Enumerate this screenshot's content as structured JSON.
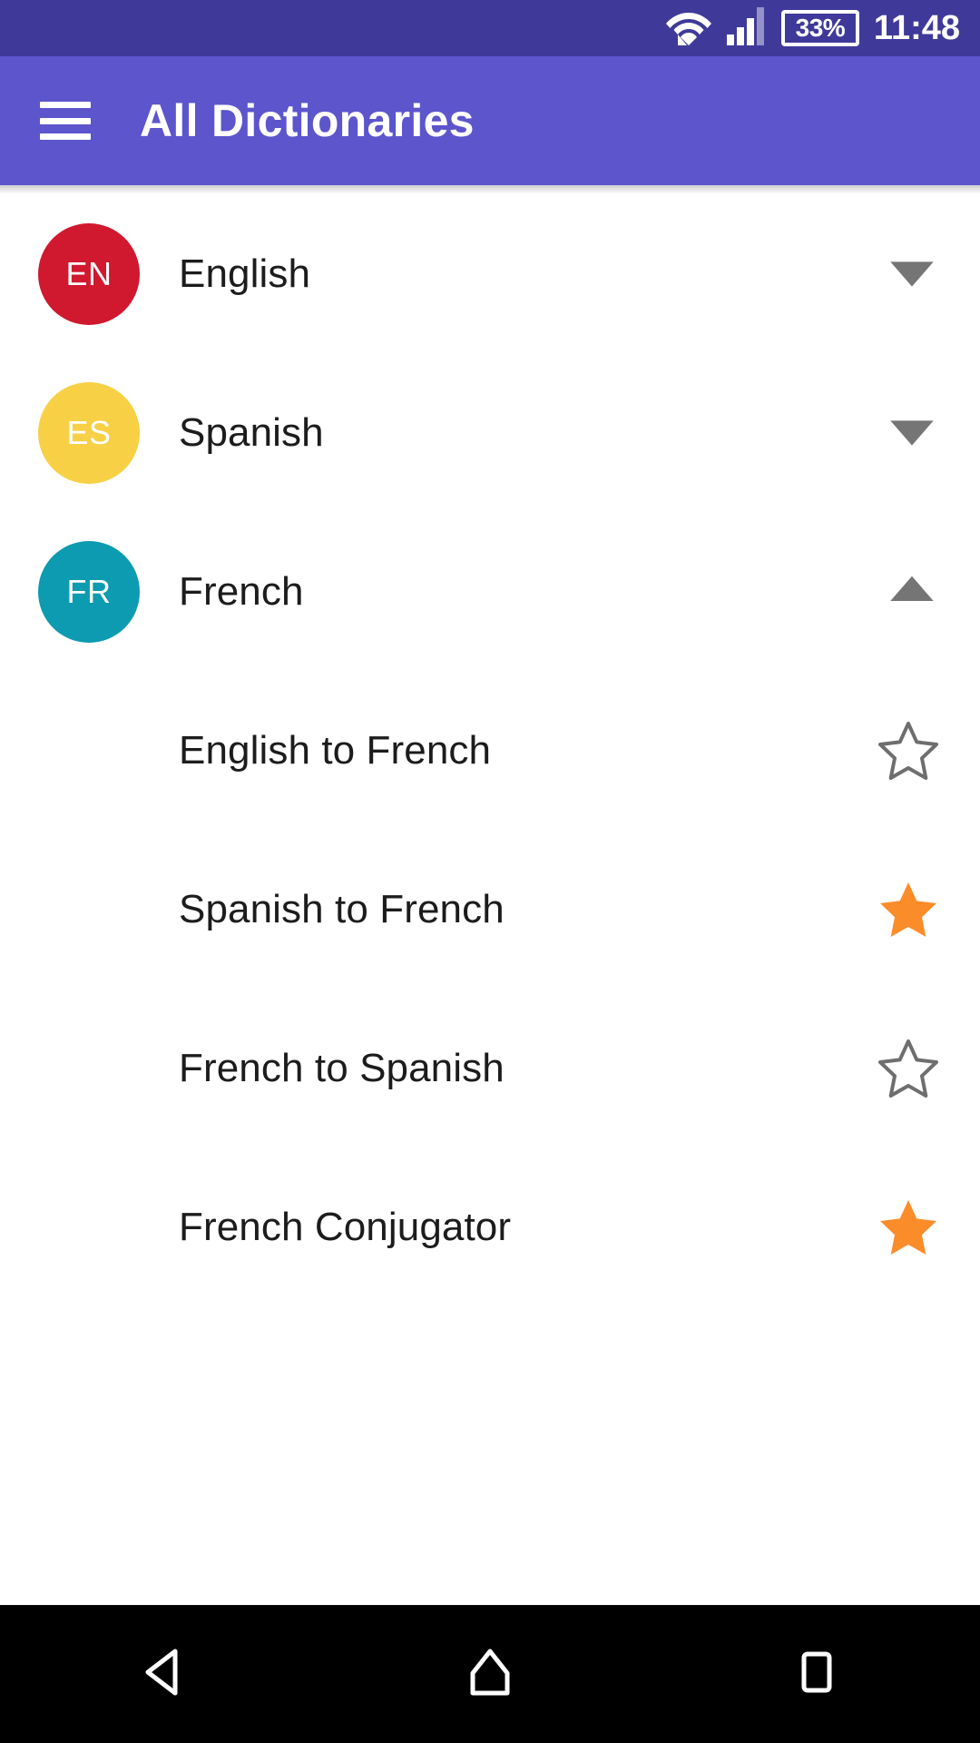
{
  "status_bar": {
    "wifi_icon": "wifi-icon",
    "signal_icon": "signal-bars-icon",
    "battery_icon": "battery-icon",
    "battery_level": "33%",
    "clock": "11:48",
    "background_color": "#3F3A99"
  },
  "app_bar": {
    "menu_icon": "hamburger-menu-icon",
    "title": "All Dictionaries",
    "background_color": "#5C55CC",
    "text_color": "#FFFFFF"
  },
  "colors": {
    "english_avatar": "#D0182F",
    "spanish_avatar": "#F7D046",
    "french_avatar": "#0C9BB0",
    "star_filled": "#FB8C2A",
    "star_outline": "#6E6E6E",
    "chevron": "#757575",
    "row_text": "#1C1C1C"
  },
  "list": [
    {
      "type": "group",
      "code": "EN",
      "label": "English",
      "avatar_color": "#D0182F",
      "expanded": false,
      "chevron_icon": "chevron-down-icon"
    },
    {
      "type": "group",
      "code": "ES",
      "label": "Spanish",
      "avatar_color": "#F7D046",
      "expanded": false,
      "chevron_icon": "chevron-down-icon"
    },
    {
      "type": "group",
      "code": "FR",
      "label": "French",
      "avatar_color": "#0C9BB0",
      "expanded": true,
      "chevron_icon": "chevron-up-icon"
    },
    {
      "type": "child",
      "label": "English to French",
      "favorite": false,
      "star_icon": "star-outline-icon"
    },
    {
      "type": "child",
      "label": "Spanish to French",
      "favorite": true,
      "star_icon": "star-filled-icon"
    },
    {
      "type": "child",
      "label": "French to Spanish",
      "favorite": false,
      "star_icon": "star-outline-icon"
    },
    {
      "type": "child",
      "label": "French Conjugator",
      "favorite": true,
      "star_icon": "star-filled-icon"
    }
  ],
  "nav_bar": {
    "background_color": "#000000",
    "buttons": [
      {
        "name": "back-button",
        "icon": "triangle-back-icon"
      },
      {
        "name": "home-button",
        "icon": "home-pentagon-icon"
      },
      {
        "name": "recents-button",
        "icon": "square-recents-icon"
      }
    ]
  }
}
